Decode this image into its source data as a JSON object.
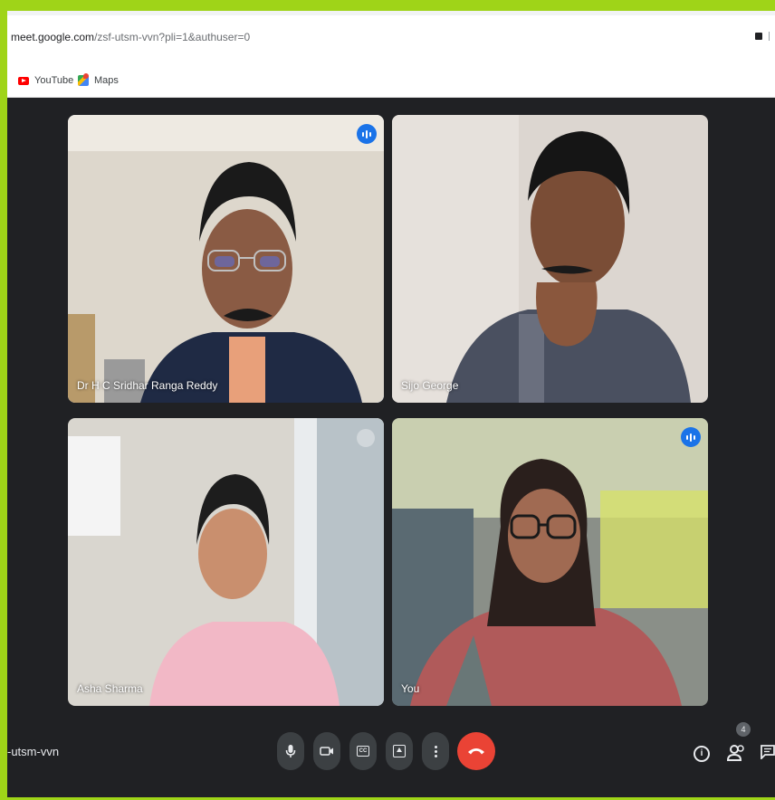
{
  "browser": {
    "url_host": "meet.google.com",
    "url_path": "/zsf-utsm-vvn?pli=1&authuser=0",
    "bookmarks": [
      {
        "label": "YouTube",
        "icon": "youtube-icon"
      },
      {
        "label": "Maps",
        "icon": "maps-icon"
      }
    ]
  },
  "meeting": {
    "code_fragment": "-utsm-vvn",
    "participant_count": "4",
    "participants": [
      {
        "name": "Dr H C Sridhar Ranga Reddy",
        "speaking": true
      },
      {
        "name": "Sijo George",
        "speaking": false
      },
      {
        "name": "Asha Sharma",
        "speaking": false
      },
      {
        "name": "You",
        "speaking": true
      }
    ]
  },
  "controls": [
    "mic-icon",
    "camera-icon",
    "captions-icon",
    "present-icon",
    "more-options-icon",
    "hang-up-icon",
    "info-icon",
    "people-icon",
    "chat-icon"
  ],
  "colors": {
    "accent_frame": "#9fd418",
    "meet_background": "#202124",
    "active_speaker_border": "#8ab4f8",
    "speaking_indicator": "#1a73e8",
    "hang_up": "#ea4335"
  }
}
